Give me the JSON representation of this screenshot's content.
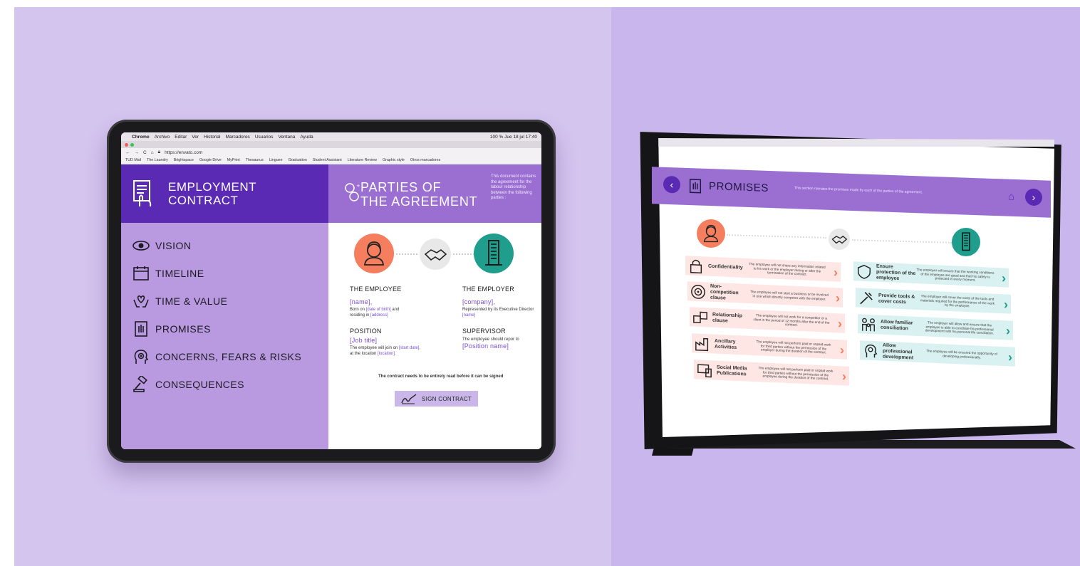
{
  "browser": {
    "menu": [
      "Chrome",
      "Archivo",
      "Editar",
      "Ver",
      "Historial",
      "Marcadores",
      "Usuarios",
      "Ventana",
      "Ayuda"
    ],
    "status": "100 %  Jue 18 jul  17:40",
    "url": "https://envato.com",
    "bookmarks": [
      "TUD Mail",
      "The Laundry",
      "Brightspace",
      "Google Drive",
      "MyPrint",
      "Thesaurus",
      "Linguee",
      "Graduation",
      "Student Assistant",
      "Literature Review",
      "Graphic style",
      "Otros marcadores"
    ]
  },
  "left": {
    "app_title_1": "EMPLOYMENT",
    "app_title_2": "CONTRACT",
    "section_title_1": "PARTIES OF",
    "section_title_2": "THE AGREEMENT",
    "section_desc": "This document contains the agreement for the labour relationship between the following parties :",
    "menu": [
      "VISION",
      "TIMELINE",
      "TIME & VALUE",
      "PROMISES",
      "CONCERNS, FEARS & RISKS",
      "CONSEQUENCES"
    ],
    "employee": {
      "heading": "THE EMPLOYEE",
      "name": "[name],",
      "born_prefix": "Born on",
      "dob": "[date of birth]",
      "and": "and",
      "residing": "residing in",
      "address": "[address]",
      "position_heading": "POSITION",
      "job": "[Job title]",
      "join_text": "The employee will join on",
      "start": "[start date],",
      "location_text": "at the location",
      "location": "[location]."
    },
    "employer": {
      "heading": "THE EMPLOYER",
      "company": "[company],",
      "rep": "Represented by its Executive Director",
      "name": "[name]",
      "supervisor_heading": "SUPERVISOR",
      "report": "The employee should repor to",
      "position": "[Position name]"
    },
    "notice": "The contract needs to be entirely read before it can be signed",
    "sign_label": "SIGN CONTRACT"
  },
  "right": {
    "title": "PROMISES",
    "desc": "This section narrates the promises made by each of the parties of the agreement.",
    "employee_promises": [
      {
        "title": "Confidentiality",
        "text": "The employee will not share any information related to his work or the employer during or after the termination of the contract."
      },
      {
        "title": "Non- competition clause",
        "text": "The employee will not start a business or be involved in one which directly competes with the employer."
      },
      {
        "title": "Relationship clause",
        "text": "The employee will not work for a competitor or a client in the period of 12 months after the end of the contract."
      },
      {
        "title": "Ancillary Activities",
        "text": "The employee will not perform paid or unpaid work for third parties without the permission of the employer during the duration of the contract."
      },
      {
        "title": "Social Media Publications",
        "text": "The employee will not perform paid or unpaid work for third parties without the permission of the employee during the duration of the contract."
      }
    ],
    "employer_promises": [
      {
        "title": "Ensure protection of the employee",
        "text": "The employer will ensure that the working conditions of the employee are good and that his safety is protected in every moment."
      },
      {
        "title": "Provide tools & cover costs",
        "text": "The employer will cover the costs of the tools and materials required for the performance of the work by the employee."
      },
      {
        "title": "Allow familiar conciliation",
        "text": "The employer will allow and ensure that the employee is able to conciliate his professional development with his personal life conciliation."
      },
      {
        "title": "Allow professional development",
        "text": "The employee will be ensured the opportunity of developing professionally."
      }
    ]
  },
  "colors": {
    "purple_dark": "#5b2ab5",
    "purple_mid": "#9b6fd1",
    "purple_light": "#b99ae0",
    "employee_orange": "#f47e5e",
    "employer_teal": "#1f9e8d",
    "pink_card": "#fde6e3",
    "teal_card": "#d9f1f0"
  }
}
